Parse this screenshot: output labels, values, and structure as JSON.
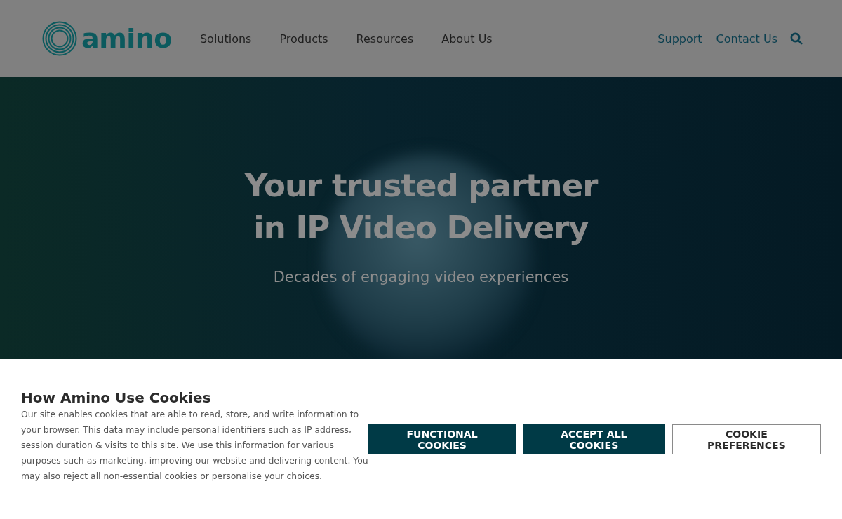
{
  "header": {
    "logo_text": "amino",
    "nav": [
      "Solutions",
      "Products",
      "Resources",
      "About Us"
    ],
    "utility_links": [
      "Support",
      "Contact Us"
    ]
  },
  "hero": {
    "title_lines": [
      "Your trusted partner",
      "in IP Video Delivery"
    ],
    "subtitle": "Decades of engaging video experiences"
  },
  "cookie_banner": {
    "title": "How Amino Use Cookies",
    "body": " Our site enables cookies that are able to read, store, and write information to your browser. This data may include personal identifiers such as IP address, session duration & visits to this site. We use this information for various purposes such as marketing, improving our website and delivering content. You may also reject all non-essential cookies or personalise your choices.",
    "buttons": [
      {
        "label": "FUNCTIONAL COOKIES",
        "kind": "filled"
      },
      {
        "label": "ACCEPT ALL COOKIES",
        "kind": "filled"
      },
      {
        "label": "COOKIE PREFERENCES",
        "kind": "outline"
      }
    ]
  }
}
